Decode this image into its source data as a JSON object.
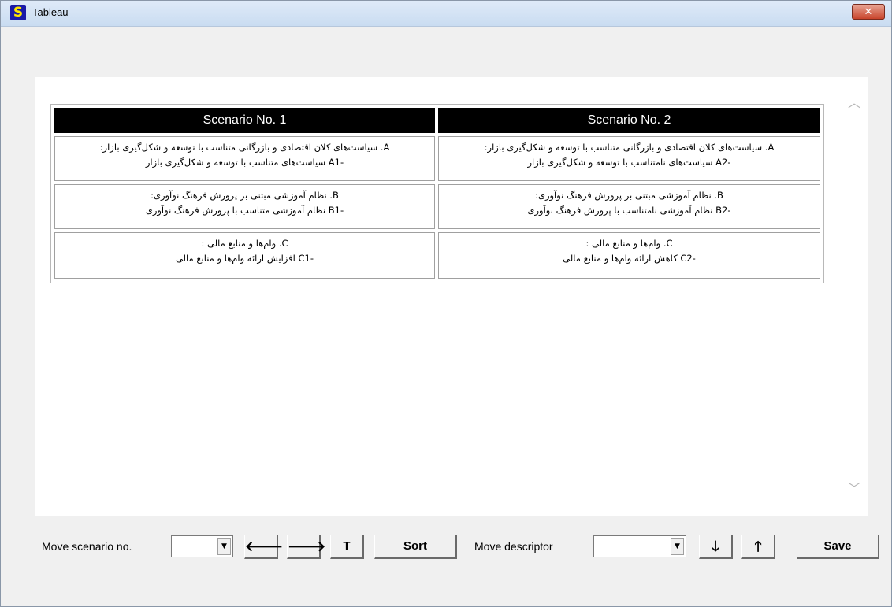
{
  "window": {
    "title": "Tableau",
    "app_icon_glyph": "S",
    "close_glyph": "✕"
  },
  "scroll": {
    "up_glyph": "︿",
    "down_glyph": "﹀"
  },
  "table": {
    "headers": [
      "Scenario No. 1",
      "Scenario No. 2"
    ],
    "rows": [
      {
        "cells": [
          {
            "line1": ":سیاست‌های کلان اقتصادی و بازرگانی متناسب با توسعه و شکل‌گیری بازار .A",
            "line2": "سیاست‌های متناسب با توسعه و شکل‌گیری بازار A1-"
          },
          {
            "line1": ":سیاست‌های کلان اقتصادی و بازرگانی متناسب با توسعه و شکل‌گیری بازار .A",
            "line2": "سیاست‌های نامتناسب با توسعه و شکل‌گیری بازار A2-"
          }
        ]
      },
      {
        "cells": [
          {
            "line1": ":نظام آموزشی مبتنی بر پرورش فرهنگ نوآوری .B",
            "line2": "نظام آموزشی متناسب با پرورش فرهنگ نوآوری B1-"
          },
          {
            "line1": ":نظام آموزشی مبتنی بر پرورش فرهنگ نوآوری .B",
            "line2": "نظام آموزشی نامتناسب با پرورش فرهنگ نوآوری B2-"
          }
        ]
      },
      {
        "cells": [
          {
            "line1": ": وام‌ها و منابع مالی .C",
            "line2": "افزایش ارائه وام‌ها و منابع مالی C1-"
          },
          {
            "line1": ": وام‌ها و منابع مالی .C",
            "line2": "کاهش ارائه وام‌ها و منابع مالی C2-"
          }
        ]
      }
    ]
  },
  "controls": {
    "move_scenario_label": "Move scenario no.",
    "move_scenario_value": "",
    "combo_arrow": "▼",
    "left_arrow": "🡐",
    "right_arrow": "🡒",
    "t_label": "T",
    "sort_label": "Sort",
    "move_descriptor_label": "Move descriptor",
    "move_descriptor_value": "",
    "down_arrow": "🡓",
    "up_arrow": "🡑",
    "save_label": "Save"
  }
}
